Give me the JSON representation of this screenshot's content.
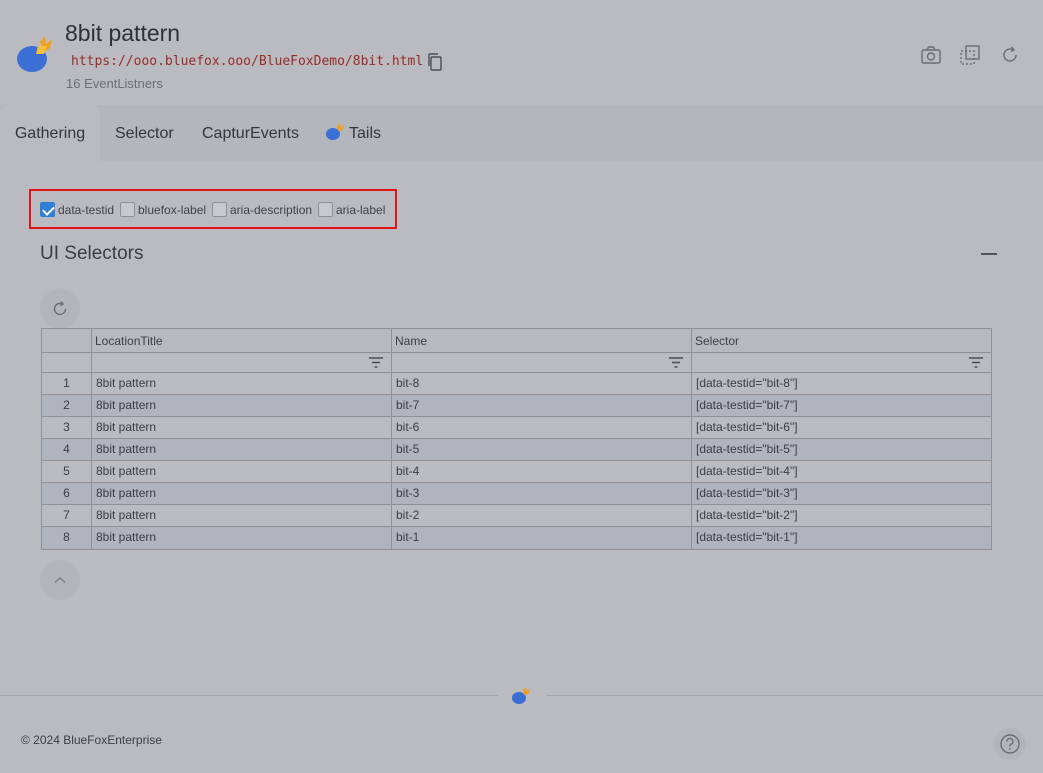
{
  "header": {
    "title": "8bit pattern",
    "url": "https://ooo.bluefox.ooo/BlueFoxDemo/8bit.html",
    "listeners": "16 EventListners",
    "icons": [
      "camera-icon",
      "select-region-icon",
      "refresh-icon"
    ]
  },
  "tabs": [
    {
      "label": "Gathering",
      "active": true
    },
    {
      "label": "Selector",
      "active": false
    },
    {
      "label": "CapturEvents",
      "active": false
    },
    {
      "label": "Tails",
      "active": false
    }
  ],
  "attributes": [
    {
      "label": "data-testid",
      "checked": true
    },
    {
      "label": "bluefox-label",
      "checked": false
    },
    {
      "label": "aria-description",
      "checked": false
    },
    {
      "label": "aria-label",
      "checked": false
    }
  ],
  "section": {
    "title": "UI Selectors"
  },
  "grid": {
    "columns": [
      "",
      "LocationTitle",
      "Name",
      "Selector"
    ],
    "rows": [
      {
        "index": "1",
        "location": "8bit pattern",
        "name": "bit-8",
        "selector": "[data-testid=\"bit-8\"]"
      },
      {
        "index": "2",
        "location": "8bit pattern",
        "name": "bit-7",
        "selector": "[data-testid=\"bit-7\"]"
      },
      {
        "index": "3",
        "location": "8bit pattern",
        "name": "bit-6",
        "selector": "[data-testid=\"bit-6\"]"
      },
      {
        "index": "4",
        "location": "8bit pattern",
        "name": "bit-5",
        "selector": "[data-testid=\"bit-5\"]"
      },
      {
        "index": "5",
        "location": "8bit pattern",
        "name": "bit-4",
        "selector": "[data-testid=\"bit-4\"]"
      },
      {
        "index": "6",
        "location": "8bit pattern",
        "name": "bit-3",
        "selector": "[data-testid=\"bit-3\"]"
      },
      {
        "index": "7",
        "location": "8bit pattern",
        "name": "bit-2",
        "selector": "[data-testid=\"bit-2\"]"
      },
      {
        "index": "8",
        "location": "8bit pattern",
        "name": "bit-1",
        "selector": "[data-testid=\"bit-1\"]"
      }
    ]
  },
  "footer": {
    "copyright": "© 2024 BlueFoxEnterprise"
  },
  "colors": {
    "accent": "#2f7fd6",
    "highlight_border": "#e01414",
    "logo_blue": "#3b6fd4",
    "logo_orange": "#f0a020"
  }
}
